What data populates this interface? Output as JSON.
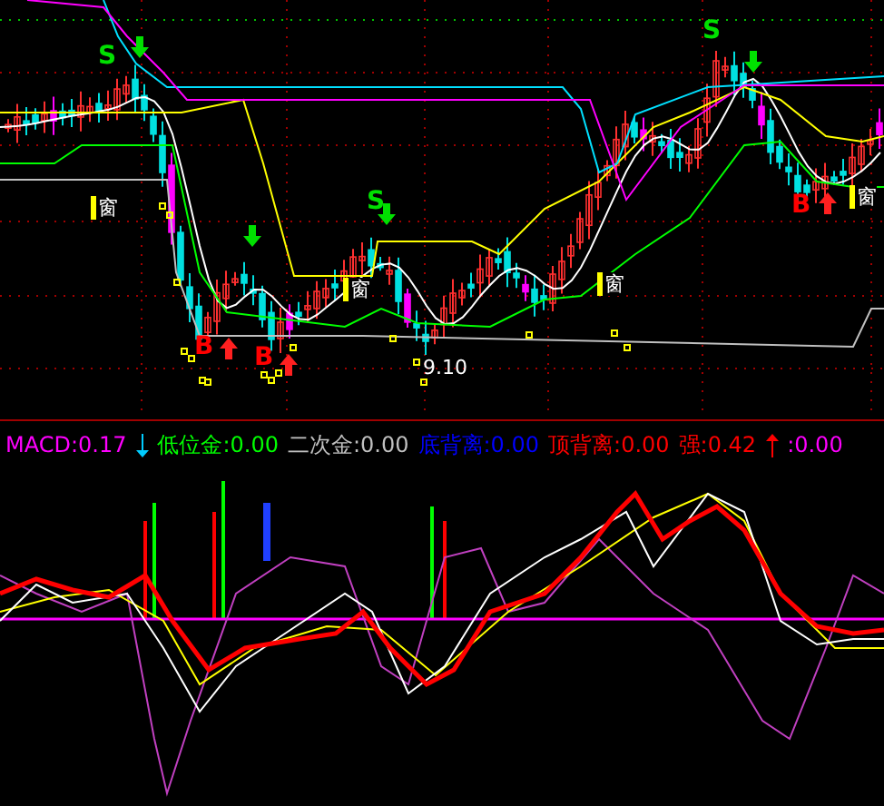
{
  "price_chart": {
    "markers": [
      {
        "kind": "sell",
        "text": "S"
      },
      {
        "kind": "sell",
        "text": "S"
      },
      {
        "kind": "sell",
        "text": "S"
      },
      {
        "kind": "buy",
        "text": "B"
      },
      {
        "kind": "buy",
        "text": "B"
      },
      {
        "kind": "buy",
        "text": "B"
      }
    ],
    "gap_labels": [
      "窗",
      "窗",
      "窗",
      "窗"
    ],
    "low_price": "9.10"
  },
  "indicator": {
    "legend": [
      {
        "kind": "text",
        "text": "MACD:0.17",
        "color": "#ff00ff"
      },
      {
        "kind": "arrow_down",
        "color": "#00ccff"
      },
      {
        "kind": "text",
        "text": "低位金:0.00",
        "color": "#00ff00"
      },
      {
        "kind": "text",
        "text": "二次金:0.00",
        "color": "#c0c0c0"
      },
      {
        "kind": "text",
        "text": "底背离:0.00",
        "color": "#0000ff"
      },
      {
        "kind": "text",
        "text": "顶背离:0.00",
        "color": "#ff0000"
      },
      {
        "kind": "text",
        "text": "强:0.42",
        "color": "#ff0000"
      },
      {
        "kind": "arrow_up",
        "color": "#ff0000"
      },
      {
        "kind": "text",
        "text": ":0.00",
        "color": "#ff00ff"
      }
    ]
  }
}
